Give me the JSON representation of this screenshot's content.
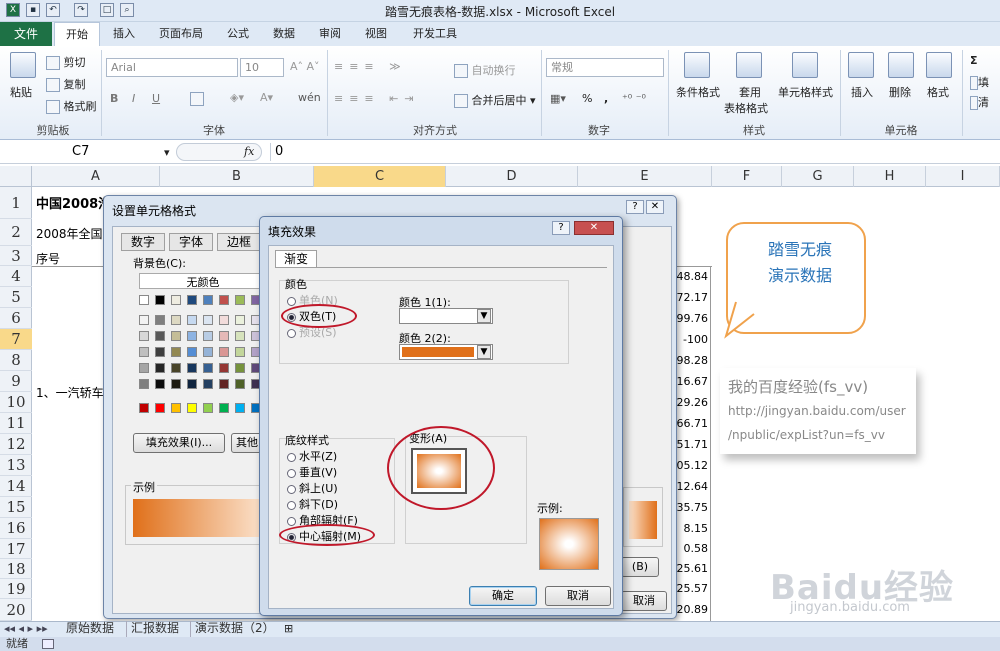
{
  "app": {
    "title": "踏雪无痕表格-数据.xlsx - Microsoft Excel"
  },
  "tabs": [
    "文件",
    "开始",
    "插入",
    "页面布局",
    "公式",
    "数据",
    "审阅",
    "视图",
    "开发工具"
  ],
  "ribbon": {
    "clipboard": {
      "paste": "粘贴",
      "cut": "剪切",
      "copy": "复制",
      "format_painter": "格式刷",
      "label": "剪贴板"
    },
    "font": {
      "name": "Arial",
      "size": "10",
      "label": "字体",
      "bold": "B",
      "italic": "I",
      "underline": "U",
      "wen": "wén"
    },
    "align": {
      "wrap": "自动换行",
      "merge": "合并后居中",
      "label": "对齐方式"
    },
    "number": {
      "format": "常规",
      "percent": "%",
      "comma": ",",
      "label": "数字"
    },
    "styles": {
      "cond": "条件格式",
      "table_fmt": "套用",
      "table_fmt2": "表格格式",
      "cell_styles": "单元格样式",
      "label": "样式"
    },
    "cells": {
      "insert": "插入",
      "delete": "删除",
      "format": "格式",
      "label": "单元格"
    },
    "editing": {
      "sum": "Σ",
      "fill": "填",
      "clear": "清"
    }
  },
  "formula": {
    "namebox": "C7",
    "fx": "fx",
    "value": "0"
  },
  "columns": [
    "A",
    "B",
    "C",
    "D",
    "E",
    "F",
    "G",
    "H",
    "I"
  ],
  "rows": [
    "1",
    "2",
    "3",
    "4",
    "5",
    "6",
    "7",
    "8",
    "9",
    "10",
    "11",
    "12",
    "13",
    "14",
    "15",
    "16",
    "17",
    "18",
    "19",
    "20"
  ],
  "cells": {
    "a1": "中国2008汽车排行榜",
    "a2": "2008年全国",
    "a3": "序号",
    "a9": "1、一汽轿车"
  },
  "column_e_values": [
    "48.84",
    "72.17",
    "99.76",
    "-100",
    "98.28",
    "16.67",
    "29.26",
    "66.71",
    "51.71",
    "05.12",
    "12.64",
    "35.75",
    "8.15",
    "0.58",
    "25.61",
    "25.57",
    "20.89"
  ],
  "sheet_tabs": [
    "原始数据",
    "汇报数据",
    "演示数据（2）"
  ],
  "status": "就绪",
  "format_dialog": {
    "title": "设置单元格格式",
    "tabs": [
      "数字",
      "字体",
      "边框"
    ],
    "bg_label": "背景色(C):",
    "no_color": "无颜色",
    "fill_effects": "填充效果(I)...",
    "other_colors": "其他",
    "sample": "示例",
    "ok_partial": "(B)",
    "cancel_partial": "取消"
  },
  "fill_dialog": {
    "title": "填充效果",
    "help": "?",
    "close": "✕",
    "tab": "渐变",
    "colors_group": "颜色",
    "one_color": "单色(N)",
    "two_colors": "双色(T)",
    "preset": "预设(S)",
    "color1": "颜色 1(1):",
    "color2": "颜色 2(2):",
    "shading_group": "底纹样式",
    "styles": [
      "水平(Z)",
      "垂直(V)",
      "斜上(U)",
      "斜下(D)",
      "角部辐射(F)",
      "中心辐射(M)"
    ],
    "variants": "变形(A)",
    "sample": "示例:",
    "ok": "确定",
    "cancel": "取消",
    "color2_hex": "#e0701a"
  },
  "watermark": {
    "callout": [
      "踏雪无痕",
      "演示数据"
    ],
    "exp": "我的百度经验(fs_vv)",
    "url1": "http://jingyan.baidu.com/user",
    "url2": "/npublic/expList?un=fs_vv",
    "baidu": "Baidu经验",
    "baidu_url": "jingyan.baidu.com"
  }
}
